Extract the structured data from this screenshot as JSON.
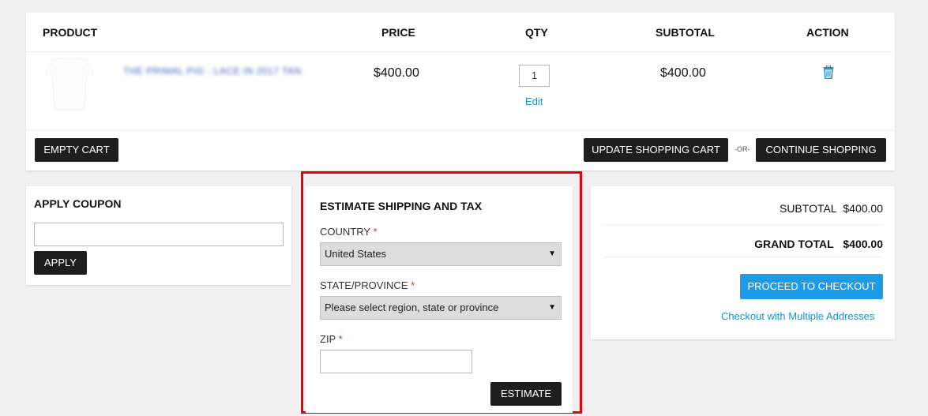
{
  "cart": {
    "headers": {
      "product": "PRODUCT",
      "price": "PRICE",
      "qty": "QTY",
      "subtotal": "SUBTOTAL",
      "action": "ACTION"
    },
    "items": [
      {
        "name": "THE PRIMAL PIG - LACE IN 2017 TAN",
        "price": "$400.00",
        "qty": "1",
        "subtotal": "$400.00",
        "edit_label": "Edit",
        "action_icon": "trash-icon"
      }
    ],
    "buttons": {
      "empty_cart": "EMPTY CART",
      "update_cart": "UPDATE SHOPPING CART",
      "or": "-OR-",
      "continue_shopping": "CONTINUE SHOPPING"
    }
  },
  "coupon": {
    "title": "APPLY COUPON",
    "input_value": "",
    "apply_label": "APPLY"
  },
  "shipping": {
    "title": "ESTIMATE SHIPPING AND TAX",
    "country_label": "COUNTRY",
    "country_value": "United States",
    "state_label": "STATE/PROVINCE",
    "state_value": "Please select region, state or province",
    "zip_label": "ZIP",
    "zip_value": "",
    "required_mark": "*",
    "estimate_label": "ESTIMATE",
    "highlight_color": "#e4000f"
  },
  "summary": {
    "subtotal_label": "SUBTOTAL",
    "subtotal_value": "$400.00",
    "grand_total_label": "GRAND TOTAL",
    "grand_total_value": "$400.00",
    "checkout_label": "PROCEED TO CHECKOUT",
    "multi_address_label": "Checkout with Multiple Addresses",
    "accent_color": "#1e9be8"
  }
}
